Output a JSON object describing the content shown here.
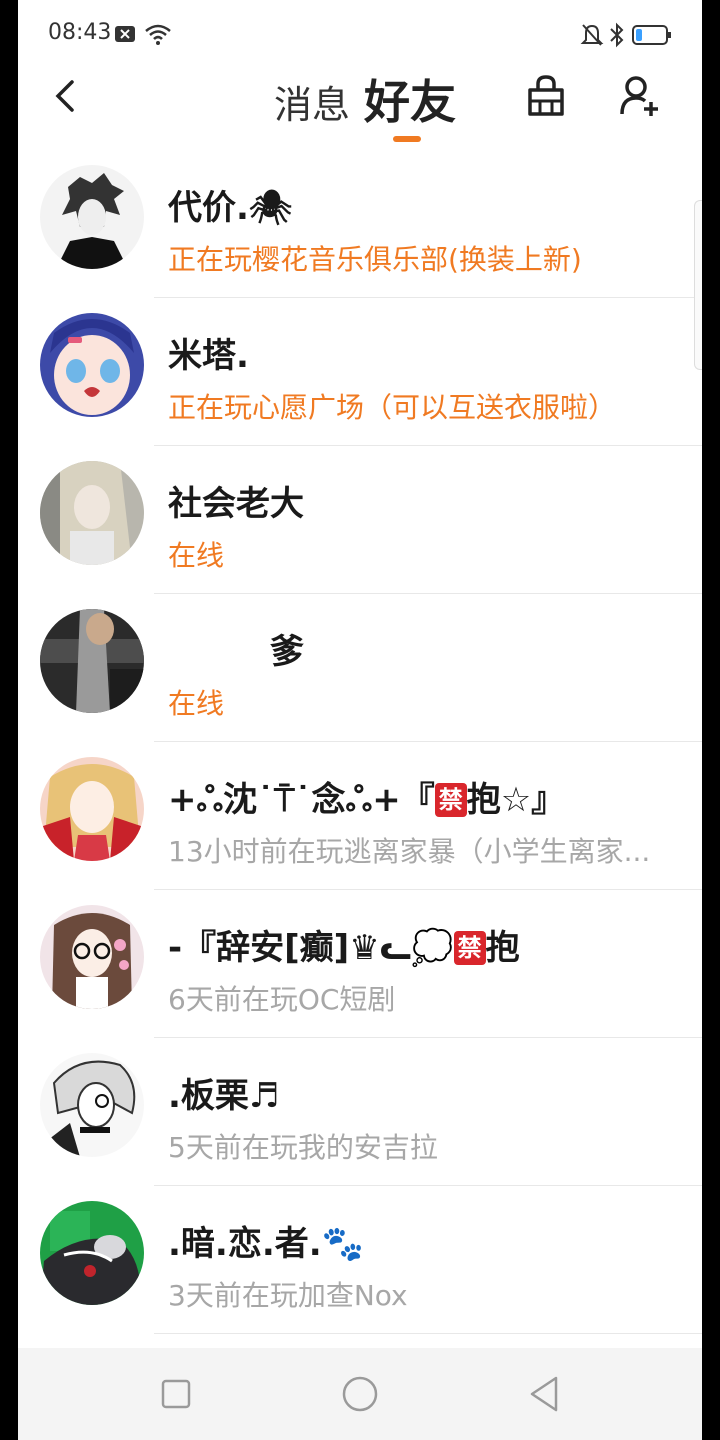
{
  "status_bar": {
    "time": "08:43",
    "icons": [
      "notification-x-icon",
      "wifi-icon",
      "bell-muted-icon",
      "bluetooth-icon",
      "battery-icon"
    ]
  },
  "header": {
    "tab_messages": "消息",
    "tab_friends": "好友",
    "accent_color": "#f07a22"
  },
  "friends": [
    {
      "name": "代价.🕷",
      "status": "正在玩樱花音乐俱乐部(换装上新)",
      "active": true
    },
    {
      "name": "米塔.",
      "status": "正在玩心愿广场（可以互送衣服啦）",
      "active": true
    },
    {
      "name": "社会老大",
      "status": "在线",
      "active": true
    },
    {
      "name": "　　　爹",
      "status": "在线",
      "active": true
    },
    {
      "name_prefix": "+ஃ沈˙⍑˙念ஃ+『",
      "name_badge": "禁",
      "name_suffix": "抱☆』",
      "status": "13小时前在玩逃离家暴（小学生离家...",
      "active": false
    },
    {
      "name_prefix": "-『辞安[癫]♛ᓚ💭",
      "name_badge": "禁",
      "name_suffix": "抱",
      "status": "6天前在玩OC短剧",
      "active": false
    },
    {
      "name": ".板栗♬",
      "status": "5天前在玩我的安吉拉",
      "active": false
    },
    {
      "name": ".暗.恋.者.🐾",
      "status": "3天前在玩加查Nox",
      "active": false
    }
  ],
  "nav_bar": {
    "icons": [
      "recent-apps-icon",
      "home-icon",
      "back-triangle-icon"
    ]
  }
}
